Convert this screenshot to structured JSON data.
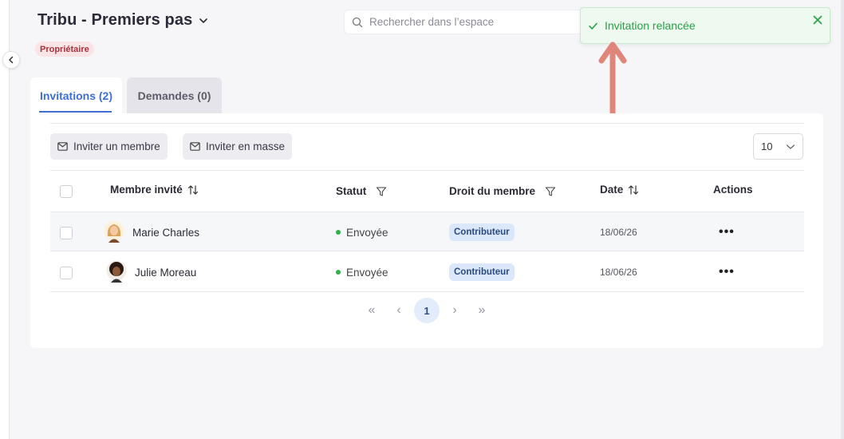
{
  "header": {
    "space_title": "Tribu - Premiers pas",
    "role_badge": "Propriétaire",
    "search_placeholder": "Rechercher dans l’espace"
  },
  "toast": {
    "message": "Invitation relancée",
    "color": "#25a244"
  },
  "tabs": [
    {
      "label": "Invitations (2)",
      "active": true
    },
    {
      "label": "Demandes (0)",
      "active": false
    }
  ],
  "toolbar": {
    "invite_member": "Inviter un membre",
    "invite_bulk": "Inviter en masse",
    "per_page": "10"
  },
  "table": {
    "columns": {
      "member": "Membre invité",
      "status": "Statut",
      "role": "Droit du membre",
      "date": "Date",
      "actions": "Actions"
    },
    "rows": [
      {
        "name": "Marie Charles",
        "status": "Envoyée",
        "role": "Contributeur",
        "date": "18/06/26",
        "actions": "•••"
      },
      {
        "name": "Julie Moreau",
        "status": "Envoyée",
        "role": "Contributeur",
        "date": "18/06/26",
        "actions": "•••"
      }
    ]
  },
  "pagination": {
    "first": "«",
    "prev": "‹",
    "current": "1",
    "next": "›",
    "last": "»"
  },
  "colors": {
    "accent": "#3d6fd6",
    "status_dot": "#2fb34a",
    "role_pill_bg": "#dbe7fb",
    "badge_bg": "#fbe4e6",
    "annotation_arrow": "#e0857a"
  }
}
